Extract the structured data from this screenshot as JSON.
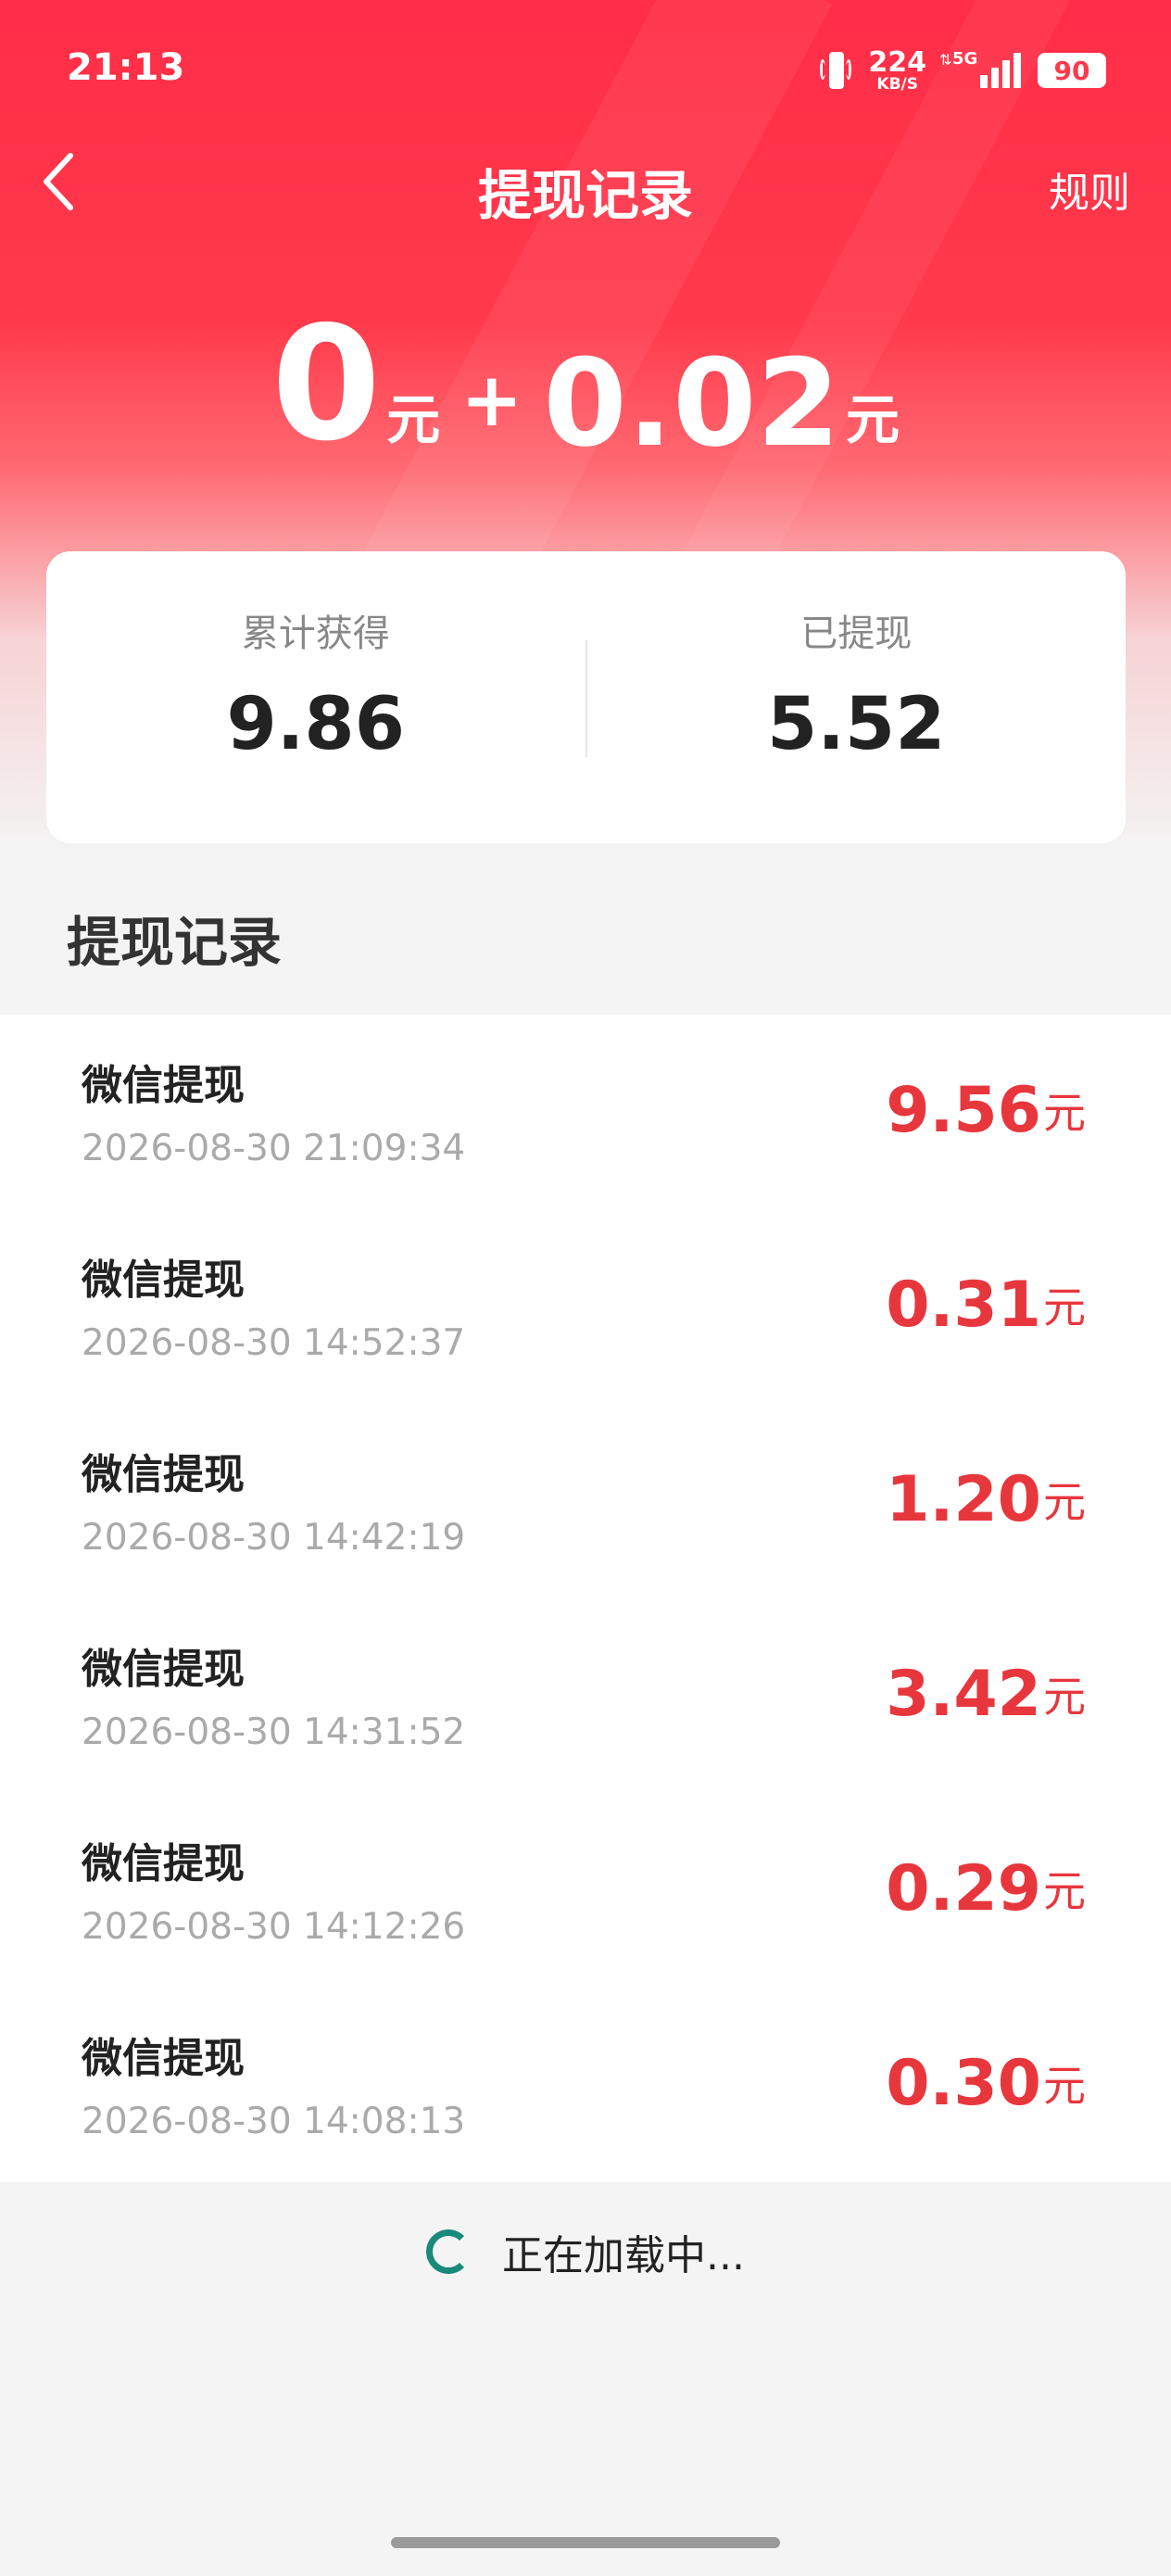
{
  "status_bar": {
    "time": "21:13",
    "speed_value": "224",
    "speed_unit": "KB/S",
    "network": "5G",
    "battery": "90"
  },
  "nav": {
    "title": "提现记录",
    "rules_label": "规则",
    "back_icon": "chevron-left-icon"
  },
  "balance": {
    "main_amount": "0",
    "main_unit": "元",
    "plus": "+",
    "sub_amount": "0.02",
    "sub_unit": "元"
  },
  "summary": {
    "earned_label": "累计获得",
    "earned_value": "9.86",
    "withdrawn_label": "已提现",
    "withdrawn_value": "5.52"
  },
  "section_title": "提现记录",
  "records": [
    {
      "title": "微信提现",
      "time": "2026-08-30 21:09:34",
      "amount": "9.56",
      "unit": "元"
    },
    {
      "title": "微信提现",
      "time": "2026-08-30 14:52:37",
      "amount": "0.31",
      "unit": "元"
    },
    {
      "title": "微信提现",
      "time": "2026-08-30 14:42:19",
      "amount": "1.20",
      "unit": "元"
    },
    {
      "title": "微信提现",
      "time": "2026-08-30 14:31:52",
      "amount": "3.42",
      "unit": "元"
    },
    {
      "title": "微信提现",
      "time": "2026-08-30 14:12:26",
      "amount": "0.29",
      "unit": "元"
    },
    {
      "title": "微信提现",
      "time": "2026-08-30 14:08:13",
      "amount": "0.30",
      "unit": "元"
    }
  ],
  "loading_text": "正在加载中...",
  "colors": {
    "brand_red": "#ff2d46",
    "amount_red": "#e8363d",
    "spinner": "#1a8a7a"
  }
}
